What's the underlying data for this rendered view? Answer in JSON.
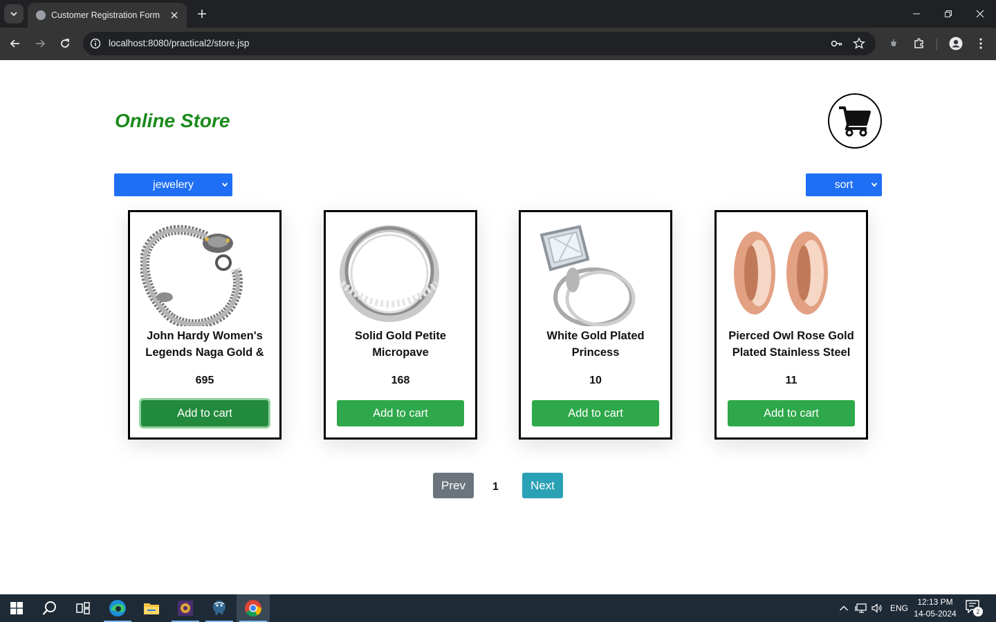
{
  "browser": {
    "tab_title": "Customer Registration Form",
    "url": "localhost:8080/practical2/store.jsp"
  },
  "store": {
    "title": "Online Store",
    "category_select": {
      "selected": "jewelery"
    },
    "sort_select": {
      "selected": "sort"
    },
    "products": [
      {
        "name": "John Hardy Women's Legends Naga Gold &",
        "price": "695",
        "button": "Add to cart",
        "image": "silver-dragon-bracelet"
      },
      {
        "name": "Solid Gold Petite Micropave",
        "price": "168",
        "button": "Add to cart",
        "image": "silver-ring"
      },
      {
        "name": "White Gold Plated Princess",
        "price": "10",
        "button": "Add to cart",
        "image": "diamond-ring-set"
      },
      {
        "name": "Pierced Owl Rose Gold Plated Stainless Steel",
        "price": "11",
        "button": "Add to cart",
        "image": "rose-gold-tunnel-plugs"
      }
    ],
    "pagination": {
      "prev": "Prev",
      "page": "1",
      "next": "Next"
    }
  },
  "taskbar": {
    "apps": [
      "start-icon",
      "search-icon",
      "task-view-icon",
      "edge-icon",
      "file-explorer-icon",
      "app-icon",
      "postgres-icon",
      "chrome-icon"
    ],
    "language": "ENG",
    "time": "12:13 PM",
    "date": "14-05-2024",
    "notification_count": "2"
  },
  "colors": {
    "title_green": "#1a8a1a",
    "select_blue": "#1f6ff5",
    "button_green": "#2ea84a",
    "prev_gray": "#6c757d",
    "next_teal": "#2aa1b4"
  }
}
